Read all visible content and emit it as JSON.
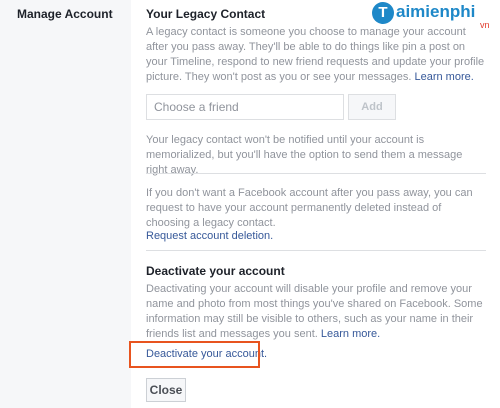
{
  "sidebar": {
    "title": "Manage Account"
  },
  "legacy": {
    "heading": "Your Legacy Contact",
    "description": "A legacy contact is someone you choose to manage your account after you pass away. They'll be able to do things like pin a post on your Timeline, respond to new friend requests and update your profile picture. They won't post as you or see your messages.",
    "learn_more": "Learn more.",
    "input_placeholder": "Choose a friend",
    "add_label": "Add",
    "note": "Your legacy contact won't be notified until your account is memorialized, but you'll have the option to send them a message right away."
  },
  "deletion": {
    "text": "If you don't want a Facebook account after you pass away, you can request to have your account permanently deleted instead of choosing a legacy contact.",
    "link": "Request account deletion."
  },
  "deactivate": {
    "heading": "Deactivate your account",
    "description": "Deactivating your account will disable your profile and remove your name and photo from most things you've shared on Facebook. Some information may still be visible to others, such as your name in their friends list and messages you sent.",
    "learn_more": "Learn more.",
    "link": "Deactivate your account.",
    "close_label": "Close"
  },
  "watermark": {
    "initial": "T",
    "text": "aimienphi",
    "suffix": "vn",
    "color": "#1e88c8"
  },
  "colors": {
    "link": "#365899",
    "muted": "#90949c",
    "highlight": "#e8541f"
  }
}
